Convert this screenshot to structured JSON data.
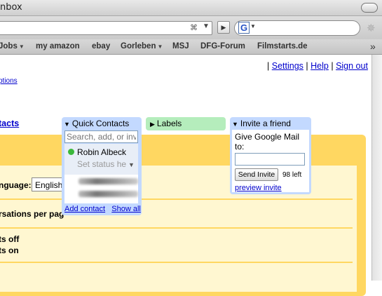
{
  "window": {
    "title": "nbox"
  },
  "toolbar": {
    "rss_icon": "rss-icon",
    "search_engine_icon": "G"
  },
  "bookmarks": [
    {
      "label": "Jobs",
      "has_menu": true
    },
    {
      "label": "my amazon",
      "has_menu": false
    },
    {
      "label": "ebay",
      "has_menu": false
    },
    {
      "label": "Gorleben",
      "has_menu": true
    },
    {
      "label": "MSJ",
      "has_menu": false
    },
    {
      "label": "DFG-Forum",
      "has_menu": false
    },
    {
      "label": "Filmstarts.de",
      "has_menu": false
    }
  ],
  "top_links": {
    "settings": "Settings",
    "help": "Help",
    "sign_out": "Sign out",
    "separator": "|"
  },
  "left_links": {
    "options": "ptions",
    "contacts": "tacts"
  },
  "settings": {
    "language_label": "nguage:",
    "language_value": "English",
    "conversations_label": "rsations per pag",
    "option_off": "ts off",
    "option_on": "ts on"
  },
  "quick_contacts": {
    "title": "Quick Contacts",
    "search_placeholder": "Search, add, or inv",
    "me_name": "Robin Albeck",
    "me_status_placeholder": "Set status he",
    "add_contact": "Add contact",
    "show_all": "Show all"
  },
  "labels": {
    "title": "Labels"
  },
  "invite": {
    "title": "Invite a friend",
    "prompt": "Give Google Mail to:",
    "send_button": "Send Invite",
    "left_count": "98 left",
    "preview_link": "preview invite"
  }
}
